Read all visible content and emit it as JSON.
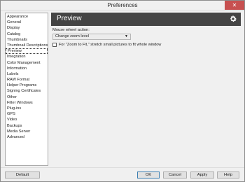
{
  "window": {
    "title": "Preferences",
    "close_glyph": "✕"
  },
  "sidebar": {
    "items": [
      {
        "label": "Appearance"
      },
      {
        "label": "General"
      },
      {
        "label": "Display"
      },
      {
        "label": "Catalog"
      },
      {
        "label": "Thumbnails"
      },
      {
        "label": "Thumbnail Descriptions"
      },
      {
        "label": "Preview",
        "selected": true
      },
      {
        "label": "Integration"
      },
      {
        "label": "Color Management"
      },
      {
        "label": "Information"
      },
      {
        "label": "Labels"
      },
      {
        "label": "RAW Format"
      },
      {
        "label": "Helper Programs"
      },
      {
        "label": "Signing Certificates"
      },
      {
        "label": "Other"
      },
      {
        "label": "Filter Windows"
      },
      {
        "label": "Plug-ins"
      },
      {
        "label": "GPS"
      },
      {
        "label": "Video"
      },
      {
        "label": "Backups"
      },
      {
        "label": "Media Server"
      },
      {
        "label": "Advanced"
      }
    ]
  },
  "panel": {
    "title": "Preview",
    "header_color": "#444444",
    "gear_icon": "gear-icon",
    "mouse_wheel_label": "Mouse wheel action:",
    "mouse_wheel_value": "Change zoom level",
    "fit_checkbox_label": "For \"Zoom to Fit,\" stretch small pictures to fit whole window",
    "fit_checkbox_checked": false
  },
  "footer": {
    "default_label": "Default",
    "ok_label": "OK",
    "cancel_label": "Cancel",
    "apply_label": "Apply",
    "help_label": "Help"
  }
}
